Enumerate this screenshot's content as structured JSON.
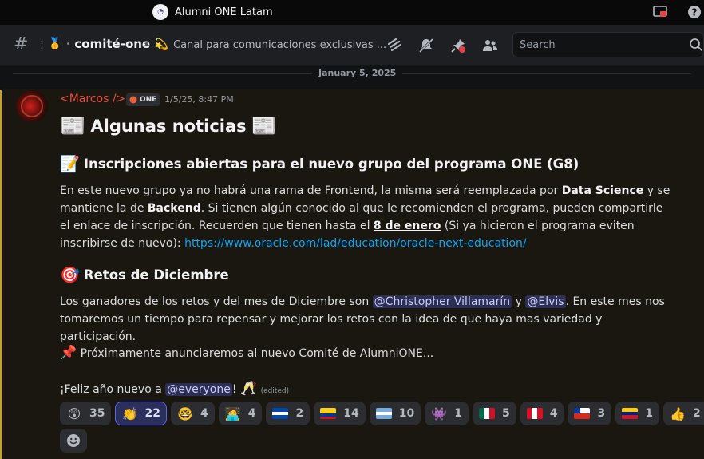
{
  "window": {
    "title": "Alumni ONE Latam"
  },
  "channel": {
    "name": "comité-one",
    "topic": "Canal para comunicaciones exclusivas ..."
  },
  "search": {
    "placeholder": "Search"
  },
  "date_divider": "January 5, 2025",
  "message": {
    "author": "<Marcos />",
    "tag": "ONE",
    "timestamp": "1/5/25, 8:47 PM",
    "heading": "Algunas noticias",
    "section1_title": "Inscripciones abiertas para el nuevo grupo del programa ONE (G8)",
    "section1_p1": "En este nuevo grupo ya no habrá una rama de Frontend, la misma será reemplazada por ",
    "section1_b1": "Data Science",
    "section1_p2": " y se mantiene la de ",
    "section1_b2": "Backend",
    "section1_p3": ". Si tienen algún conocido al que le recomienden el programa, pueden compartirle el enlace de inscripción. Recuerden que tienen hasta el ",
    "section1_b3": "8 de enero",
    "section1_p4": " (Si ya hicieron el programa eviten inscribirse de nuevo): ",
    "section1_link": "https://www.oracle.com/lad/education/oracle-next-education/",
    "section2_title": "Retos de Diciembre",
    "section2_p1": "Los ganadores de los retos y del mes de Diciembre son ",
    "section2_mention1": "@Christopher Villamarín",
    "section2_p2": " y ",
    "section2_mention2": "@Elvis",
    "section2_p3": ". En este mes nos tomaremos un tiempo para repensar y mejorar los retos con la idea de que haya mas variedad y participación.",
    "announcement": "Próximamente anunciaremos al nuevo Comité de AlumniONE...",
    "closing_p1": "¡Feliz año nuevo a ",
    "closing_mention": "@everyone",
    "closing_p2": "!",
    "edited": "(edited)"
  },
  "reactions": [
    {
      "icon": "astonished-face",
      "count": "35"
    },
    {
      "icon": "clapping-hands",
      "count": "22",
      "active": true
    },
    {
      "icon": "nerd-face",
      "count": "4"
    },
    {
      "icon": "person-at-computer",
      "count": "4"
    },
    {
      "icon": "flag-el-salvador",
      "count": "2"
    },
    {
      "icon": "flag-colombia",
      "count": "14"
    },
    {
      "icon": "flag-argentina",
      "count": "10"
    },
    {
      "icon": "alien-monster",
      "count": "1"
    },
    {
      "icon": "flag-mexico",
      "count": "5"
    },
    {
      "icon": "flag-peru",
      "count": "4"
    },
    {
      "icon": "flag-chile",
      "count": "3"
    },
    {
      "icon": "flag-venezuela",
      "count": "1"
    },
    {
      "icon": "thumbs-up",
      "count": "2"
    }
  ],
  "colors": {
    "author": "#e84a3c",
    "link": "#00a8fc",
    "highlight_bar": "#c9a227",
    "mention_bg": "#3c4270"
  }
}
